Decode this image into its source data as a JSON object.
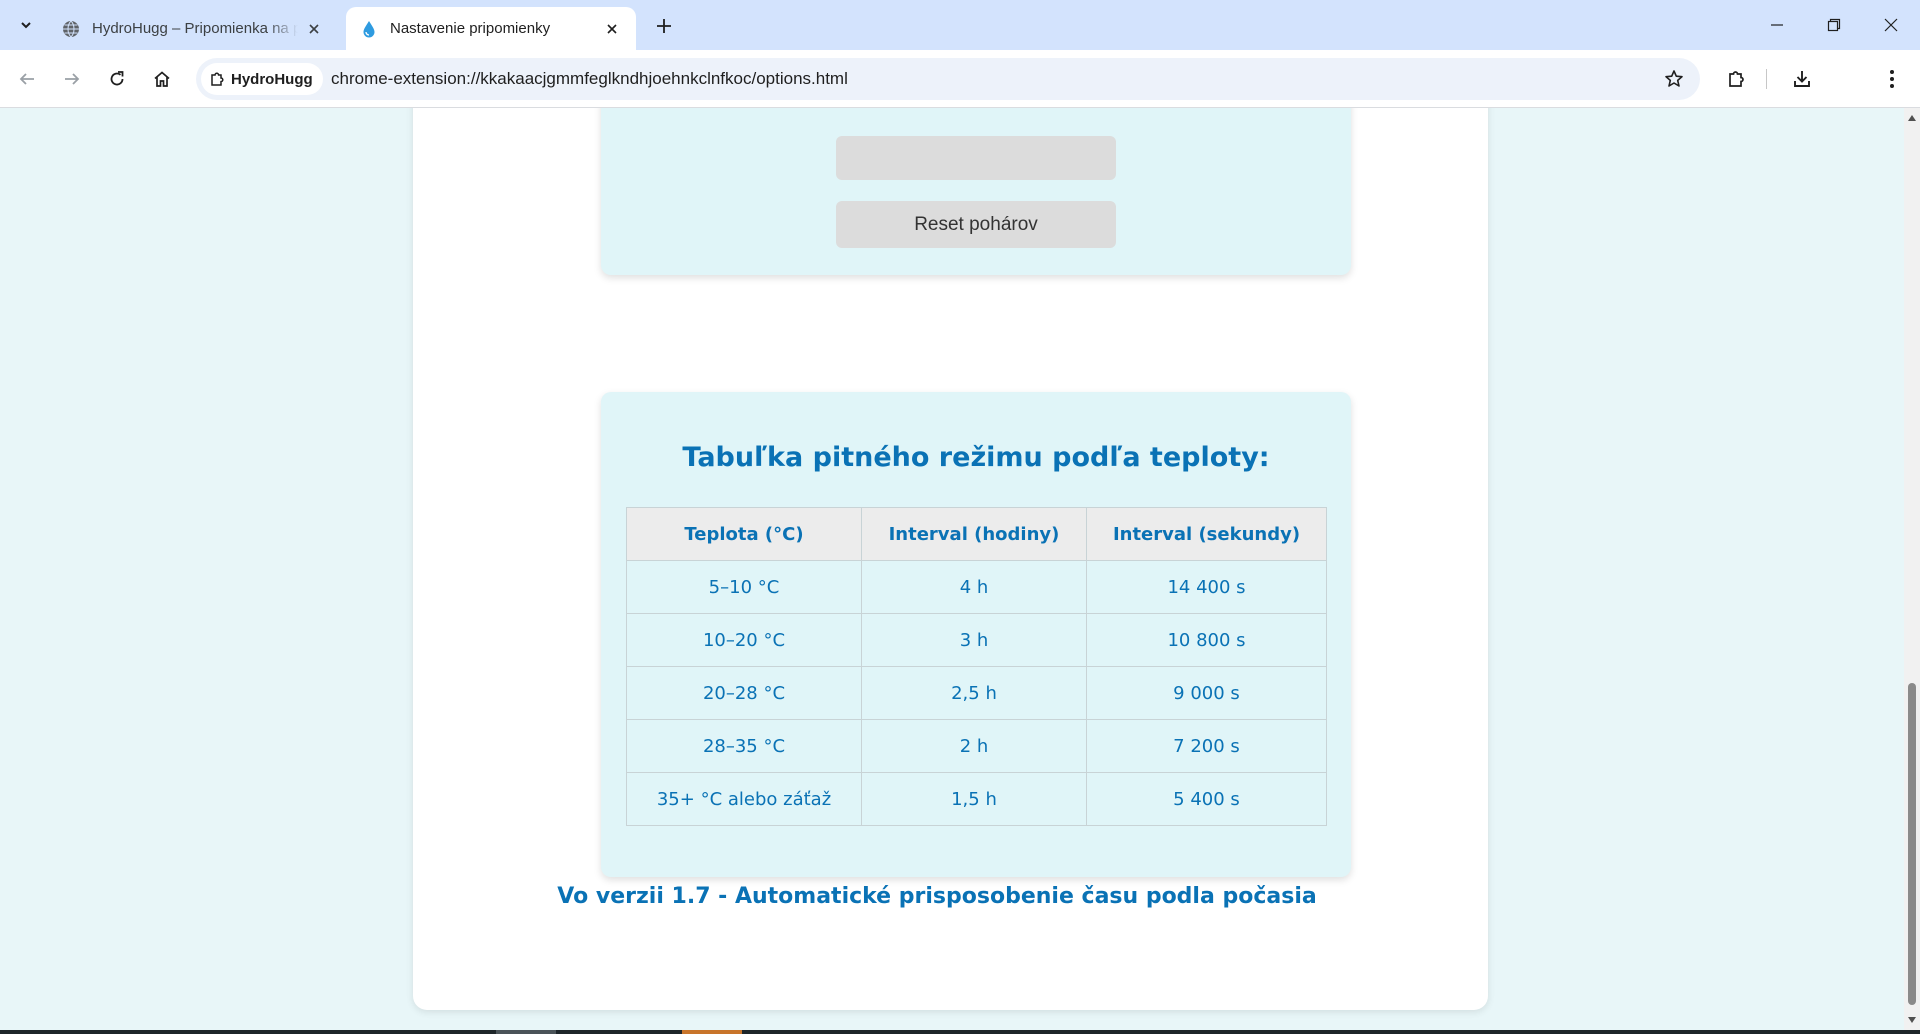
{
  "browser": {
    "tabs": [
      {
        "title": "HydroHugg – Pripomienka na p",
        "active": false,
        "favicon": "globe-icon"
      },
      {
        "title": "Nastavenie pripomienky",
        "active": true,
        "favicon": "water-drop-icon"
      }
    ],
    "site_chip": "HydroHugg",
    "url": "chrome-extension://kkakaacjgmmfeglkndhjoehnkclnfkoc/options.html"
  },
  "page": {
    "reset_button_label": "Reset pohárov",
    "table_title": "Tabuľka pitného režimu podľa teploty:",
    "table": {
      "headers": [
        "Teplota (°C)",
        "Interval (hodiny)",
        "Interval (sekundy)"
      ],
      "rows": [
        [
          "5–10 °C",
          "4 h",
          "14 400 s"
        ],
        [
          "10–20 °C",
          "3 h",
          "10 800 s"
        ],
        [
          "20–28 °C",
          "2,5 h",
          "9 000 s"
        ],
        [
          "28–35 °C",
          "2 h",
          "7 200 s"
        ],
        [
          "35+ °C alebo záťaž",
          "1,5 h",
          "5 400 s"
        ]
      ]
    },
    "footer_text": "Vo verzii 1.7 - Automatické prisposobenie času podla počasia"
  },
  "colors": {
    "accent": "#0a72b5",
    "card_background": "#e0f5f8",
    "page_background": "#e8f6f8",
    "tabstrip_background": "#d3e3fd"
  }
}
